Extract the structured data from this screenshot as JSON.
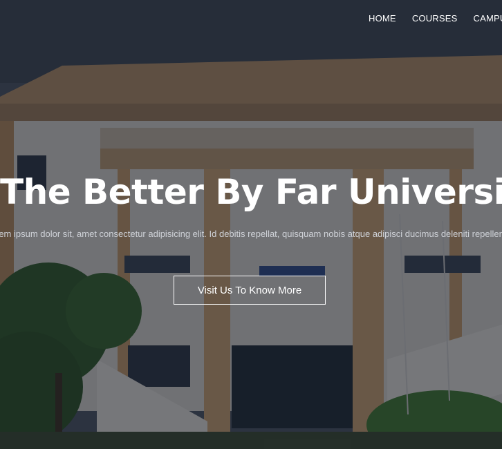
{
  "nav": {
    "items": [
      {
        "label": "HOME"
      },
      {
        "label": "COURSES"
      },
      {
        "label": "CAMPUS"
      }
    ]
  },
  "hero": {
    "title": "The Better By Far University",
    "subtitle": "rem ipsum dolor sit, amet consectetur adipisicing elit. Id debitis repellat, quisquam nobis atque adipisci ducimus deleniti repellend",
    "cta_label": "Visit Us To Know More"
  },
  "colors": {
    "overlay": "#12161e",
    "text": "#ffffff",
    "building": "#c9a27a",
    "sky": "#3a4350"
  }
}
